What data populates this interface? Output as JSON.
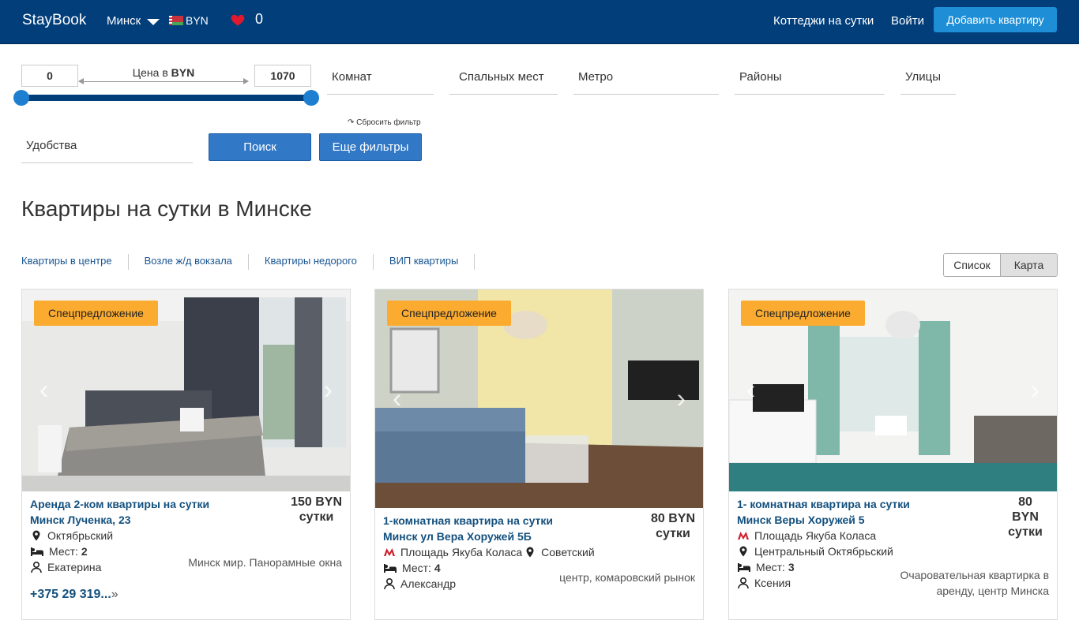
{
  "navbar": {
    "brand": "StayBook",
    "city": "Минск",
    "currency": "BYN",
    "favorites_count": "0",
    "cottages_link": "Коттеджи на сутки",
    "login_link": "Войти",
    "add_button": "Добавить квартиру",
    "colors": {
      "bar": "#013e7a",
      "button": "#1e8ed6",
      "heart": "#e0192e"
    }
  },
  "filters": {
    "price_min": "0",
    "price_max": "1070",
    "price_label_prefix": "Цена в",
    "price_label_currency": "BYN",
    "rooms": "Комнат",
    "beds": "Спальных мест",
    "metro": "Метро",
    "districts": "Районы",
    "streets": "Улицы",
    "amenities": "Удобства",
    "reset": "Сбросить фильтр",
    "search_button": "Поиск",
    "more_button": "Еще фильтры"
  },
  "page": {
    "title": "Квартиры на сутки в Минске"
  },
  "quick_links": [
    "Квартиры в центре",
    "Возле ж/д вокзала",
    "Квартиры недорого",
    "ВИП квартиры"
  ],
  "view_toggle": {
    "list": "Список",
    "map": "Карта"
  },
  "listings": [
    {
      "badge": "Спецпредложение",
      "title_line1": "Аренда 2-ком квартиры на сутки",
      "title_line2": "Минск Лученка, 23",
      "price": "150 BYN",
      "price_unit": "сутки",
      "district": "Октябрьский",
      "places_label": "Мест:",
      "places": "2",
      "host": "Екатерина",
      "description": "Минск мир. Панорамные окна",
      "phone": "+375 29 319..."
    },
    {
      "badge": "Спецпредложение",
      "title_line1": "1-комнатная квартира на сутки",
      "title_line2": "Минск ул Вера Хоружей 5Б",
      "price": "80 BYN",
      "price_unit": "сутки",
      "metro": "Площадь Якуба Коласа",
      "district": "Советский",
      "places_label": "Мест:",
      "places": "4",
      "host": "Александр",
      "description": "центр, комаровский рынок"
    },
    {
      "badge": "Спецпредложение",
      "title_line1": "1- комнатная квартира на сутки",
      "title_line2": "Минск Веры Хоружей 5",
      "price_num": "80",
      "price_cur": "BYN",
      "price_unit": "сутки",
      "metro": "Площадь Якуба Коласа",
      "district": "Центральный Октябрьский",
      "places_label": "Мест:",
      "places": "3",
      "host": "Ксения",
      "description_line1": "Очаровательная квартирка в",
      "description_line2": "аренду, центр Минска"
    }
  ]
}
